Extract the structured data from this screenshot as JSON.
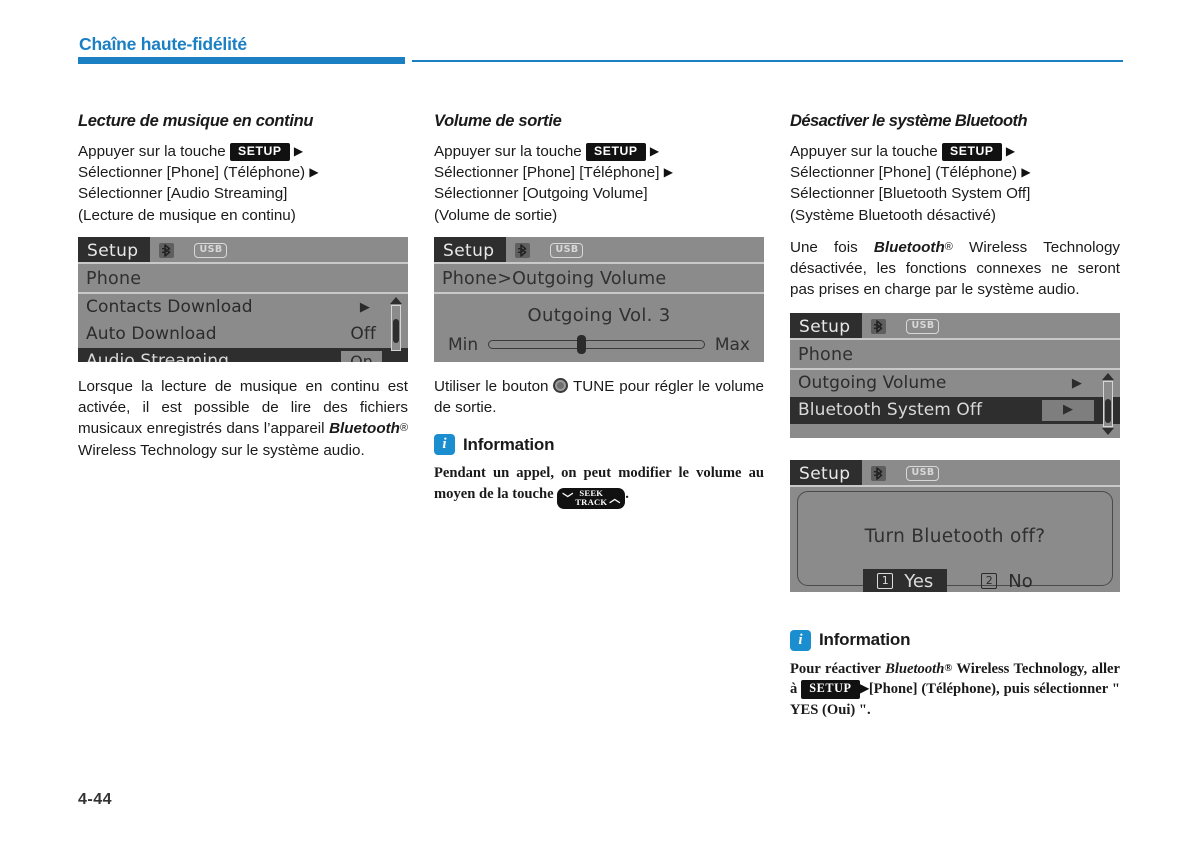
{
  "header": {
    "title": "Chaîne haute-fidélité",
    "accent_color": "#1b7fc4"
  },
  "footer": {
    "page_number": "4-44"
  },
  "columns": [
    {
      "id": "audio-streaming",
      "title": "Lecture de musique en continu",
      "steps": {
        "line1_pre": "Appuyer sur la touche",
        "setup_key": "SETUP",
        "line2": "Sélectionner [Phone] (Téléphone)",
        "line3": "Sélectionner [Audio Streaming]",
        "line4": "(Lecture de musique en continu)"
      },
      "screen": {
        "tab": "Setup",
        "bt_icon": "bluetooth-icon",
        "usb_label": "USB",
        "subtitle": "Phone",
        "rows": [
          {
            "label": "Contacts Download",
            "value": "",
            "arrow": "▶",
            "selected": false
          },
          {
            "label": "Auto Download",
            "value": "Off",
            "arrow": "",
            "selected": false
          },
          {
            "label": "Audio Streaming",
            "value": "On",
            "arrow": "",
            "selected": true
          }
        ]
      },
      "note": "Lorsque la lecture de musique en continu est activée, il est possible de lire des fichiers musicaux enregistrés dans l’appareil Bluetooth® Wireless Technology sur le système audio."
    },
    {
      "id": "outgoing-volume",
      "title": "Volume de sortie",
      "steps": {
        "line1_pre": "Appuyer sur la touche",
        "setup_key": "SETUP",
        "line2": "Sélectionner [Phone] [Téléphone]",
        "line3": "Sélectionner [Outgoing Volume]",
        "line4": "(Volume de sortie)"
      },
      "screen": {
        "tab": "Setup",
        "bt_icon": "bluetooth-icon",
        "usb_label": "USB",
        "subtitle": "Phone>Outgoing Volume",
        "vol_title": "Outgoing Vol. 3",
        "min_label": "Min",
        "max_label": "Max",
        "value": 3,
        "min": 0,
        "max": 7
      },
      "note_pre": "Utiliser le bouton",
      "note_knob": "tune-knob-icon",
      "note_post": "TUNE pour régler le volume de sortie.",
      "information": {
        "badge": "i",
        "label": "Information",
        "text_pre": "Pendant un appel, on peut modifier le volume au moyen de la touche",
        "key_up": "︿",
        "key_down": "﹀",
        "key_line1": "SEEK",
        "key_line2": "TRACK",
        "text_post": "."
      }
    },
    {
      "id": "bluetooth-system-off",
      "title": "Désactiver le système Bluetooth",
      "steps": {
        "line1_pre": "Appuyer sur la touche",
        "setup_key": "SETUP",
        "line2": "Sélectionner [Phone] (Téléphone)",
        "line3": "Sélectionner [Bluetooth System Off]",
        "line4": "(Système Bluetooth désactivé)"
      },
      "note": "Une fois Bluetooth® Wireless Technology désactivée, les fonctions connexes ne seront pas prises en charge par le système audio.",
      "screen_menu": {
        "tab": "Setup",
        "bt_icon": "bluetooth-icon",
        "usb_label": "USB",
        "subtitle": "Phone",
        "rows": [
          {
            "label": "Outgoing Volume",
            "value": "",
            "arrow": "▶",
            "selected": false
          },
          {
            "label": "Bluetooth System Off",
            "value": "",
            "arrow": "▶",
            "selected": true
          }
        ]
      },
      "screen_dialog": {
        "tab": "Setup",
        "bt_icon": "bluetooth-icon",
        "usb_label": "USB",
        "question": "Turn Bluetooth off?",
        "yes_num": "①",
        "yes_label": "Yes",
        "no_num": "②",
        "no_label": "No"
      },
      "information": {
        "badge": "i",
        "label": "Information",
        "text_pre": "Pour réactiver",
        "bt_word": "Bluetooth",
        "text_mid": "Wireless Technology, aller à",
        "setup_key": "SETUP",
        "text_post": "[Phone] (Téléphone), puis sélectionner \" YES (Oui) \"."
      }
    }
  ]
}
